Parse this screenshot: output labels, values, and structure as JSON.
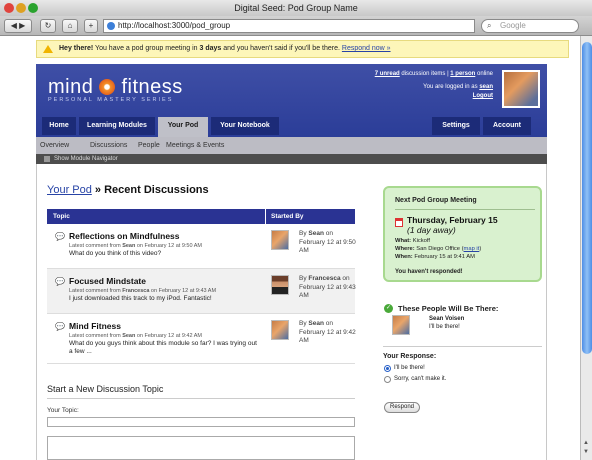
{
  "window": {
    "title": "Digital Seed: Pod Group Name"
  },
  "browser": {
    "back_glyph": "◀",
    "forward_glyph": "▶",
    "reload_glyph": "↻",
    "home_glyph": "⌂",
    "add_glyph": "+",
    "url": "http://localhost:3000/pod_group",
    "search_placeholder": "Google"
  },
  "notice": {
    "lead": "Hey there!",
    "text_1": " You have a pod group meeting in ",
    "days": "3 days",
    "text_2": " and you haven't said if you'll be there. ",
    "link": "Respond now »"
  },
  "header": {
    "logo_left": "mind",
    "logo_right": "fitness",
    "logo_sub": "PERSONAL MASTERY SERIES",
    "unread_link": "7 unread",
    "unread_text": " discussion items | ",
    "online_link": "1 person",
    "online_text": " online",
    "logged_in_text": "You are logged in as ",
    "user_link": "sean",
    "logout_link": "Logout"
  },
  "nav": {
    "tabs": [
      "Home",
      "Learning Modules",
      "Your Pod",
      "Your Notebook"
    ],
    "right_tabs": [
      "Settings",
      "Account"
    ]
  },
  "subnav": {
    "items": [
      "Overview",
      "Discussions",
      "People",
      "Meetings & Events"
    ]
  },
  "module_nav": {
    "label": "Show Module Navigator"
  },
  "page": {
    "title_link": "Your Pod",
    "title_rest": " » Recent Discussions"
  },
  "table": {
    "headers": [
      "Topic",
      "Started By"
    ],
    "rows": [
      {
        "title": "Reflections on Mindfulness",
        "meta_pre": "Latest comment from ",
        "meta_user": "Sean",
        "meta_post": " on February 12 at 9:50 AM",
        "snippet": "What do you think of this video?",
        "by_pre": "By ",
        "by_user": "Sean",
        "by_post": " on February 12 at 9:50 AM"
      },
      {
        "title": "Focused Mindstate",
        "meta_pre": "Latest comment from ",
        "meta_user": "Francesca",
        "meta_post": " on February 12 at 9:43 AM",
        "snippet": "I just downloaded this track to my iPod. Fantastic!",
        "by_pre": "By ",
        "by_user": "Francesca",
        "by_post": " on February 12 at 9:43 AM"
      },
      {
        "title": "Mind Fitness",
        "meta_pre": "Latest comment from ",
        "meta_user": "Sean",
        "meta_post": " on February 12 at 9:42 AM",
        "snippet": "What do you guys think about this module so far? I was trying out a few ...",
        "by_pre": "By ",
        "by_user": "Sean",
        "by_post": " on February 12 at 9:42 AM"
      }
    ]
  },
  "new_topic": {
    "title": "Start a New Discussion Topic",
    "topic_label": "Your Topic:"
  },
  "meeting": {
    "title": "Next Pod Group Meeting",
    "date": "Thursday, February 15",
    "away": "(1 day away)",
    "what_label": "What:",
    "what_value": " Kickoff",
    "where_label": "Where:",
    "where_value": " San Diego Office (",
    "where_map": "map it",
    "where_close": ")",
    "when_label": "When:",
    "when_value": " February 15 at 9:41 AM",
    "not_responded": "You haven't responded!"
  },
  "attendees": {
    "title": "These People Will Be There:",
    "name": "Sean Voisen",
    "message": "I'll be there!"
  },
  "response": {
    "title": "Your Response:",
    "options": [
      "I'll be there!",
      "Sorry, can't make it."
    ],
    "selected_index": 0,
    "button": "Respond"
  },
  "colors": {
    "header_blue": "#2b3d98",
    "tab_dark": "#1c2b78",
    "notice_yellow": "#fdf6b9",
    "meeting_green": "#d9f1cf",
    "link_blue": "#2844a6"
  }
}
